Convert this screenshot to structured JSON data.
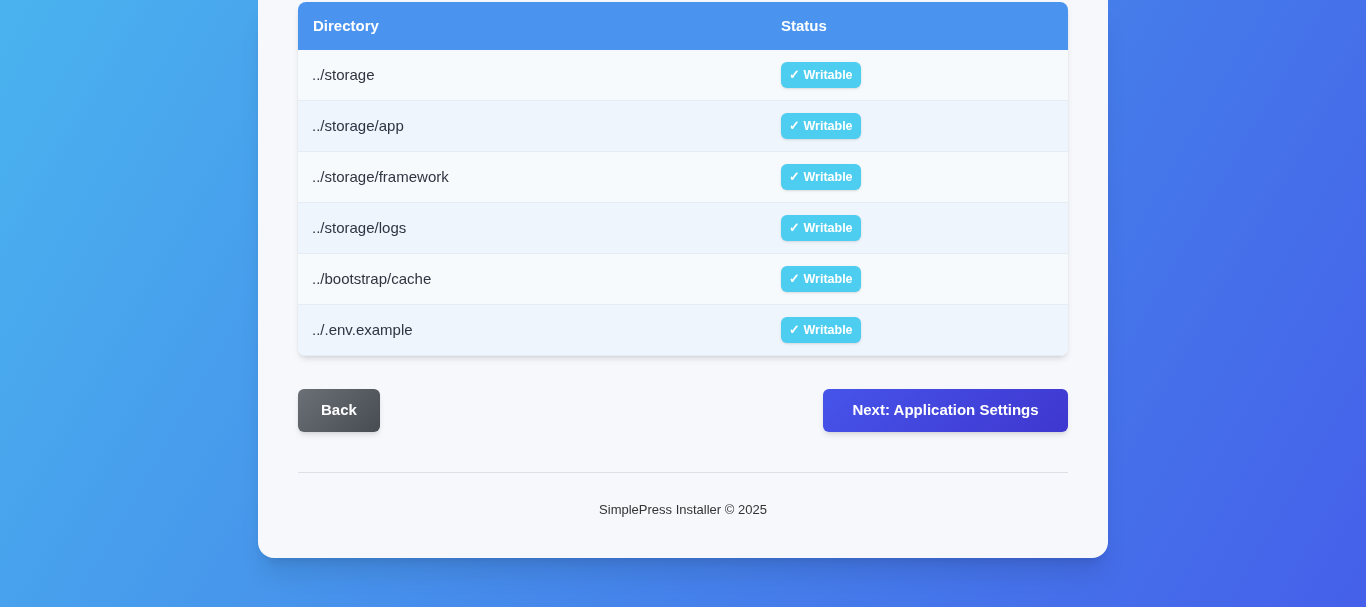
{
  "table": {
    "columns": [
      "Directory",
      "Status"
    ],
    "rows": [
      {
        "directory": "../storage",
        "status": "✓ Writable",
        "ok": true
      },
      {
        "directory": "../storage/app",
        "status": "✓ Writable",
        "ok": true
      },
      {
        "directory": "../storage/framework",
        "status": "✓ Writable",
        "ok": true
      },
      {
        "directory": "../storage/logs",
        "status": "✓ Writable",
        "ok": true
      },
      {
        "directory": "../bootstrap/cache",
        "status": "✓ Writable",
        "ok": true
      },
      {
        "directory": "../.env.example",
        "status": "✓ Writable",
        "ok": true
      }
    ]
  },
  "buttons": {
    "back": "Back",
    "next": "Next: Application Settings"
  },
  "footer": "SimplePress Installer © 2025"
}
